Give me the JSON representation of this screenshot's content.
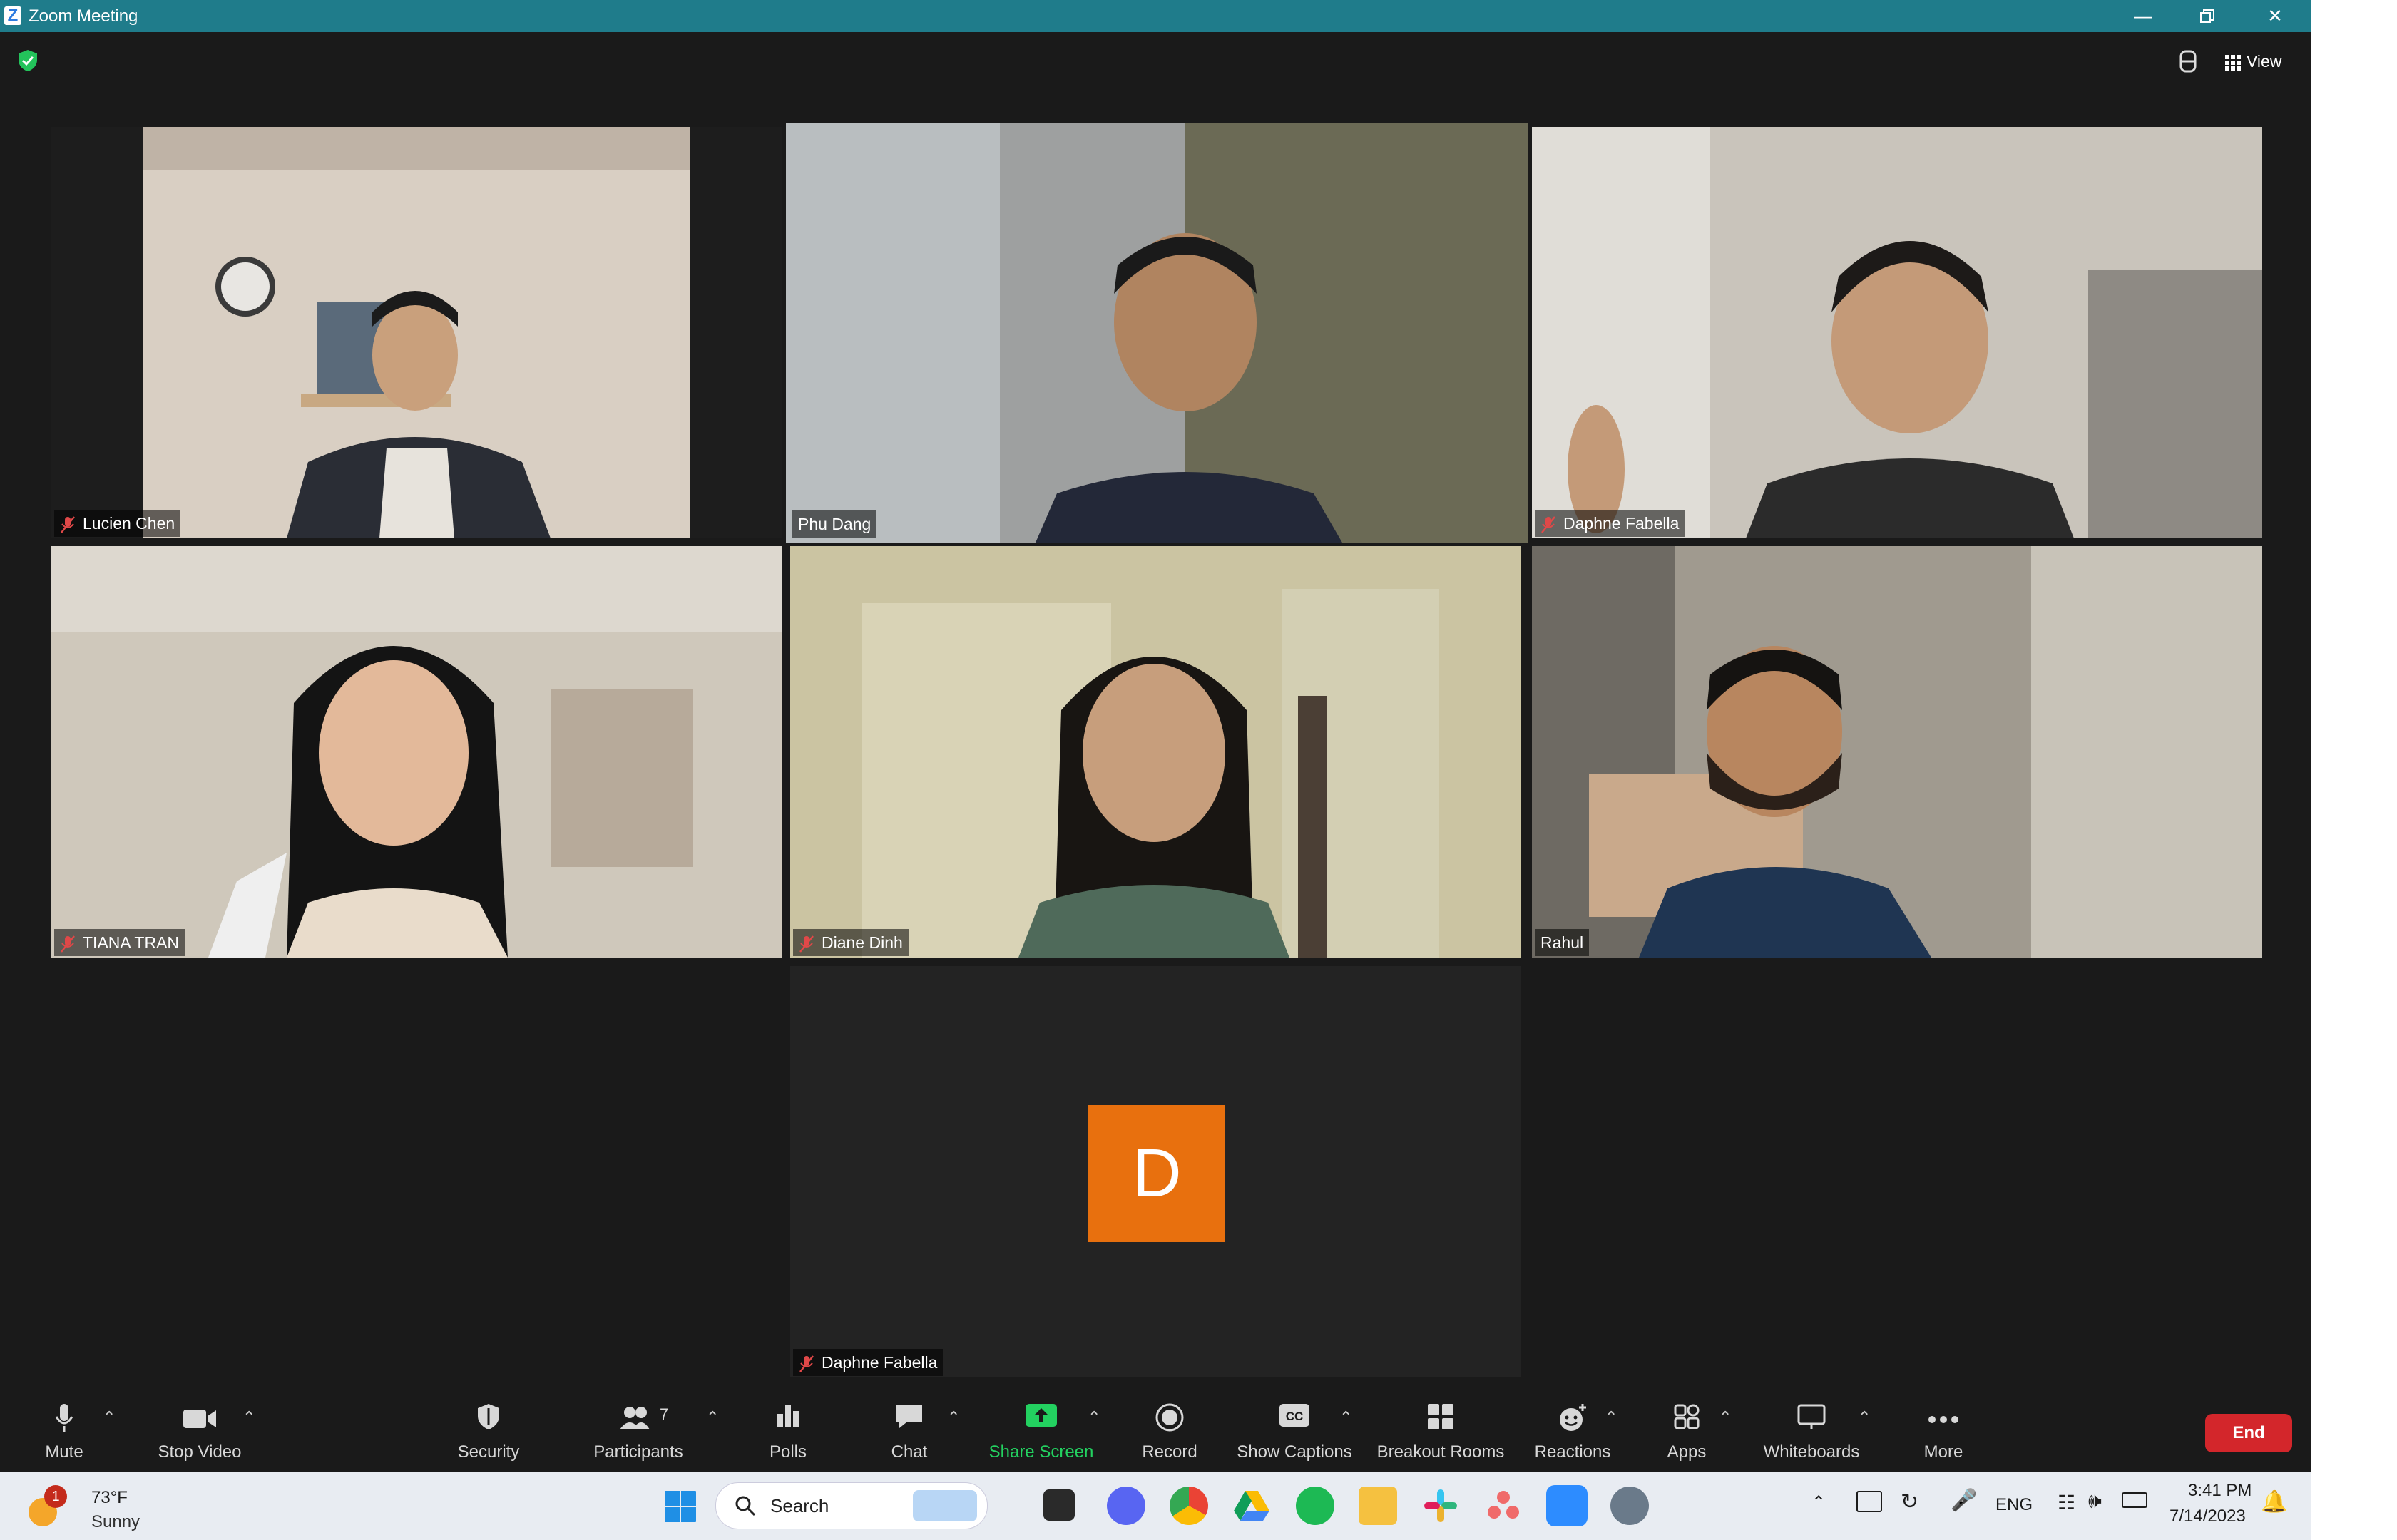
{
  "window": {
    "title": "Zoom Meeting"
  },
  "top": {
    "view_label": "View"
  },
  "participants": [
    {
      "name": "Lucien Chen",
      "muted": true
    },
    {
      "name": "Phu Dang",
      "muted": false,
      "active_speaker": true
    },
    {
      "name": "Daphne Fabella",
      "muted": true
    },
    {
      "name": "TIANA TRAN",
      "muted": true
    },
    {
      "name": "Diane Dinh",
      "muted": true
    },
    {
      "name": "Rahul",
      "muted": false
    },
    {
      "name": "Daphne Fabella",
      "muted": true,
      "video_off": true,
      "avatar_letter": "D"
    }
  ],
  "toolbar": {
    "mute": "Mute",
    "stop_video": "Stop Video",
    "security": "Security",
    "participants": "Participants",
    "participants_count": "7",
    "polls": "Polls",
    "chat": "Chat",
    "share_screen": "Share Screen",
    "record": "Record",
    "show_captions": "Show Captions",
    "breakout_rooms": "Breakout Rooms",
    "reactions": "Reactions",
    "apps": "Apps",
    "whiteboards": "Whiteboards",
    "more": "More",
    "end": "End"
  },
  "taskbar": {
    "weather_temp": "73°F",
    "weather_cond": "Sunny",
    "weather_badge": "1",
    "search_placeholder": "Search",
    "language": "ENG",
    "time": "3:41 PM",
    "date": "7/14/2023"
  },
  "colors": {
    "active_speaker_border": "#c8e05a",
    "share_green": "#23d160",
    "end_red": "#d3262b",
    "avatar_orange": "#e8700e",
    "titlebar": "#1f7c8b"
  }
}
